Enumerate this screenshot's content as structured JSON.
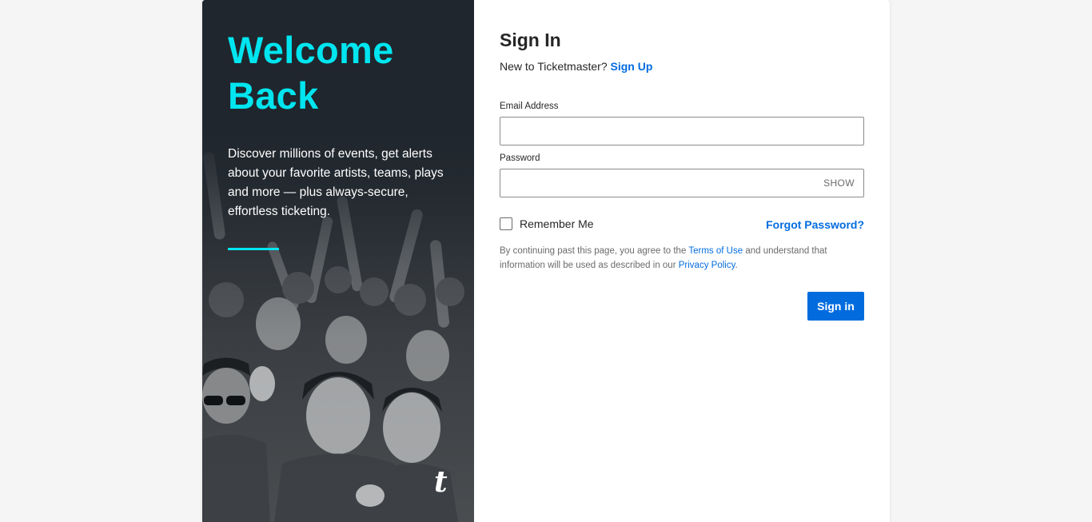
{
  "hero": {
    "title_line1": "Welcome",
    "title_line2": "Back",
    "description": "Discover millions of events, get alerts about your favorite artists, teams, plays and more — plus always-secure, effortless ticketing.",
    "logo_text": "t",
    "accent_color": "#00e5ef",
    "background_color": "#1f262d"
  },
  "form": {
    "title": "Sign In",
    "new_user_text": "New to Ticketmaster?",
    "signup_link": "Sign Up",
    "email_label": "Email Address",
    "email_value": "",
    "password_label": "Password",
    "password_value": "",
    "show_label": "SHOW",
    "remember_label": "Remember Me",
    "remember_checked": false,
    "forgot_link": "Forgot Password?",
    "legal_prefix": "By continuing past this page, you agree to the",
    "terms_link": "Terms of Use",
    "legal_middle": "and understand that information will be used as described in our",
    "privacy_link": "Privacy Policy",
    "legal_suffix": ".",
    "submit_label": "Sign in",
    "brand_color": "#026cdf"
  }
}
